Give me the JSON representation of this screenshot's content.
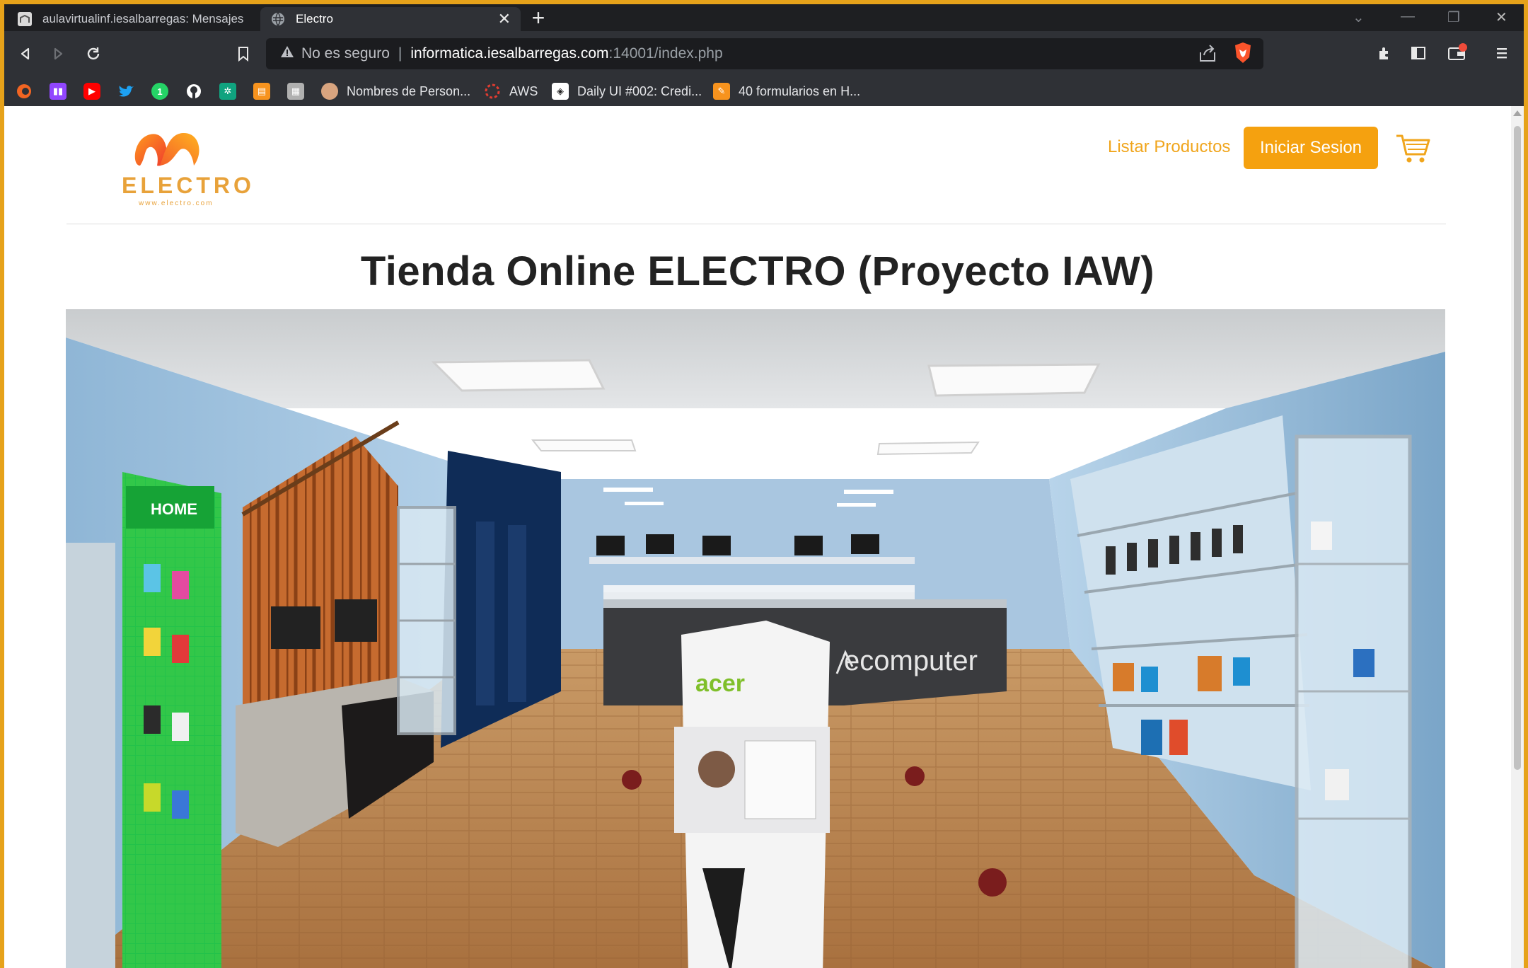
{
  "browser": {
    "tabs": [
      {
        "title": "aulavirtualinf.iesalbarregas: Mensajes",
        "active": false
      },
      {
        "title": "Electro",
        "active": true
      }
    ],
    "address": {
      "security_label": "No es seguro",
      "host": "informatica.iesalbarregas.com",
      "path": ":14001/index.php"
    },
    "bookmarks": [
      {
        "label": "",
        "icon": "orange-arc-icon",
        "color": "#f26522"
      },
      {
        "label": "",
        "icon": "twitch-icon",
        "color": "#9146ff"
      },
      {
        "label": "",
        "icon": "youtube-icon",
        "color": "#ff0000"
      },
      {
        "label": "",
        "icon": "twitter-icon",
        "color": "#1da1f2"
      },
      {
        "label": "",
        "icon": "whatsapp-icon",
        "color": "#25d366"
      },
      {
        "label": "",
        "icon": "github-icon",
        "color": "#ffffff"
      },
      {
        "label": "",
        "icon": "openai-icon",
        "color": "#10a37f"
      },
      {
        "label": "",
        "icon": "orange-doc-icon",
        "color": "#f7931e"
      },
      {
        "label": "",
        "icon": "moodle-icon",
        "color": "#b0b0b0"
      },
      {
        "label": "Nombres de Person...",
        "icon": "avatar-icon",
        "color": "#d8a47f"
      },
      {
        "label": "AWS",
        "icon": "aws-icon",
        "color": "#e03c31"
      },
      {
        "label": "Daily UI #002: Credi...",
        "icon": "dailyui-icon",
        "color": "#ffffff"
      },
      {
        "label": "40 formularios en H...",
        "icon": "pencil-icon",
        "color": "#f7931e"
      }
    ]
  },
  "site": {
    "logo_text": "ELECTRO",
    "logo_url": "www.electro.com",
    "nav_link": "Listar Productos",
    "login_button": "Iniciar Sesion",
    "heading": "Tienda Online ELECTRO (Proyecto IAW)",
    "hero_shop_sign": "ecomputer",
    "colors": {
      "accent": "#f5a10f",
      "link": "#f0a51c",
      "logo": "#e8a23a"
    }
  }
}
